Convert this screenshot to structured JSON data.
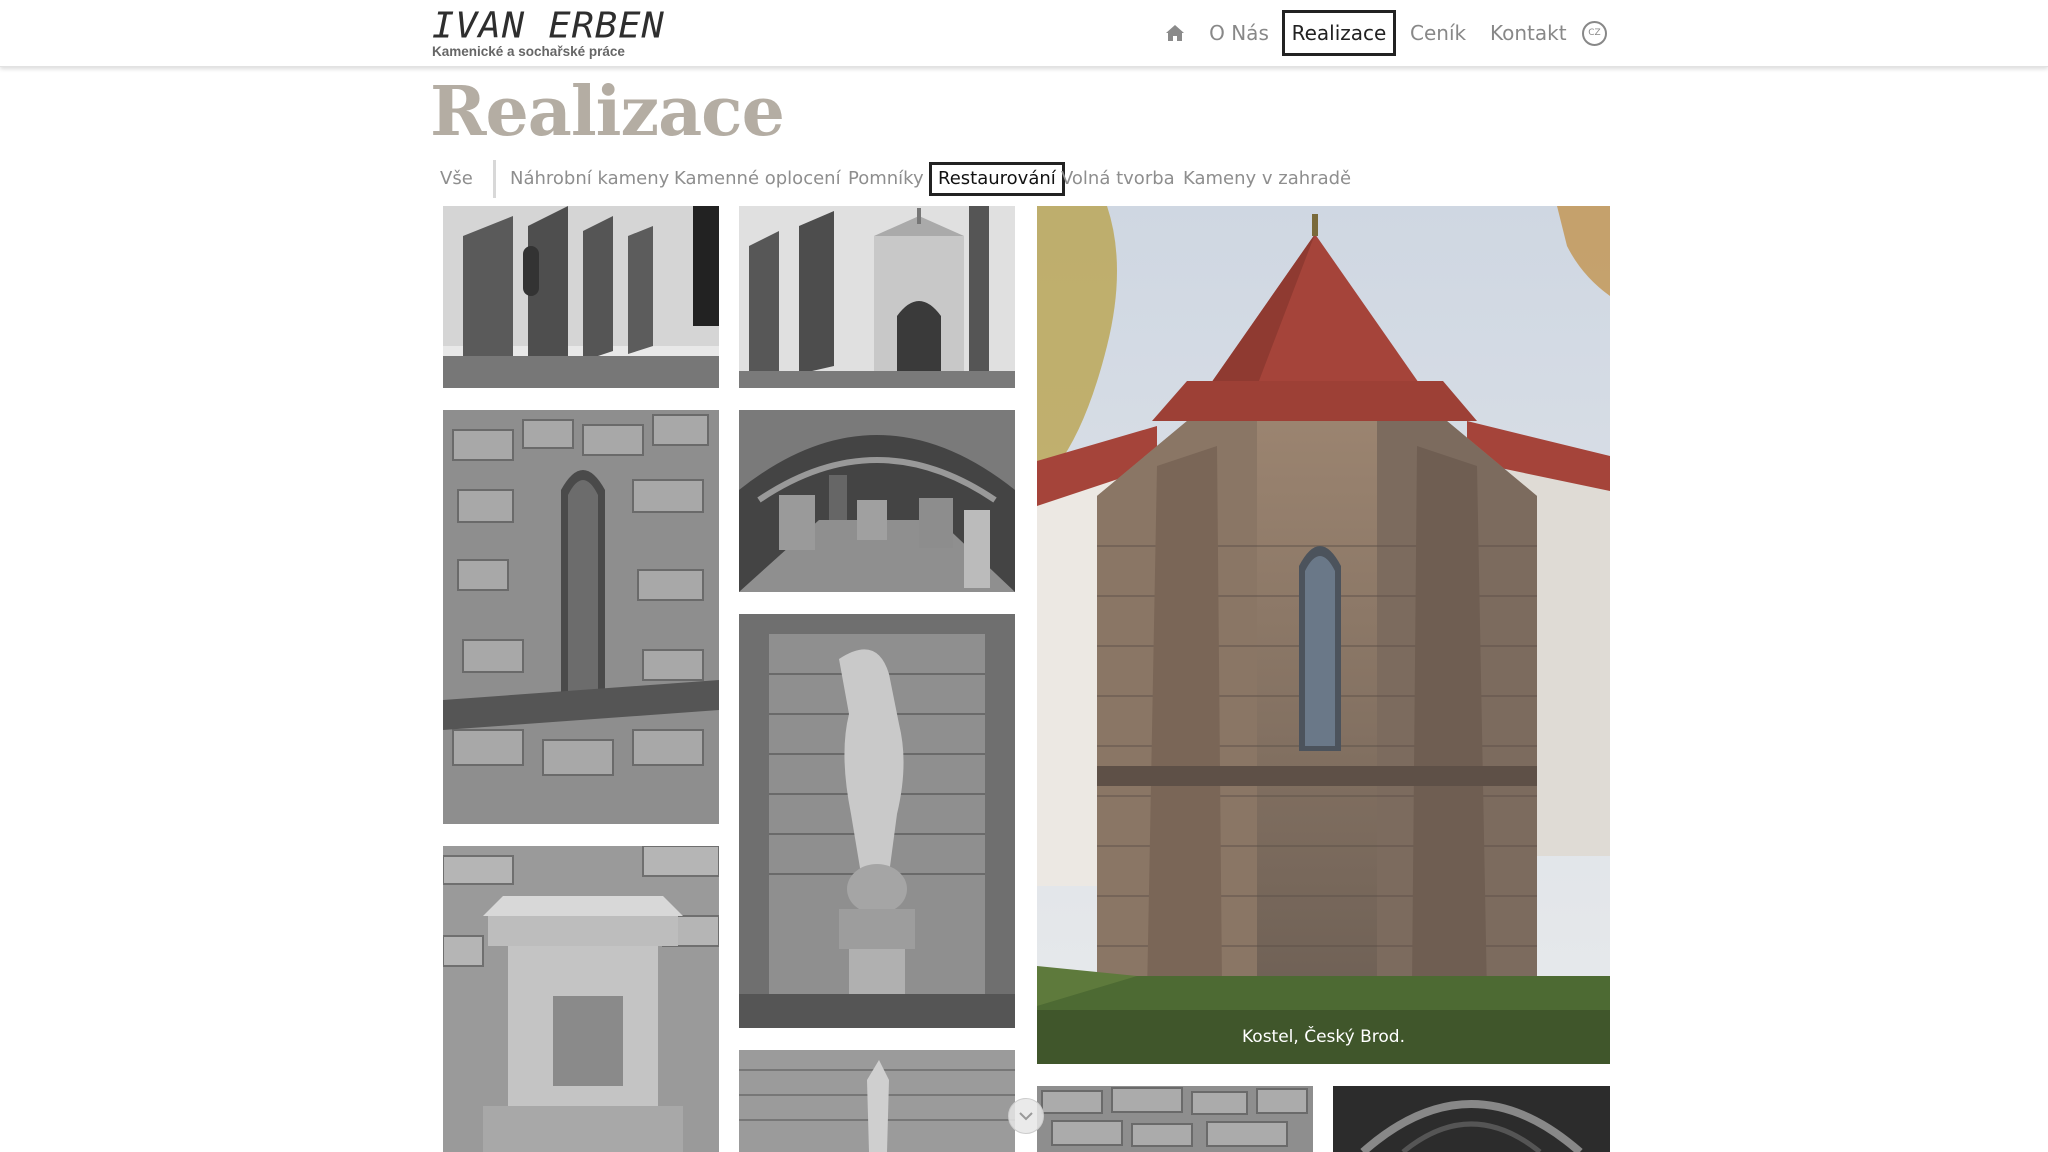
{
  "logo": {
    "title": "IVAN ERBEN",
    "tagline": "Kamenické a sochařské práce"
  },
  "nav": {
    "home_icon": "home-icon",
    "items": [
      {
        "label": "O Nás"
      },
      {
        "label": "Realizace",
        "active": true
      },
      {
        "label": "Ceník"
      },
      {
        "label": "Kontakt"
      }
    ],
    "language": "CZ"
  },
  "page": {
    "title": "Realizace"
  },
  "filters": {
    "all": "Vše",
    "items": [
      {
        "label": "Náhrobní kameny"
      },
      {
        "label": "Kamenné oplocení"
      },
      {
        "label": "Pomníky"
      },
      {
        "label": "Restaurování",
        "active": true
      },
      {
        "label": "Volná tvorba"
      },
      {
        "label": "Kameny v zahradě"
      }
    ]
  },
  "gallery": {
    "featured_caption": "Kostel, Český Brod.",
    "scroll_icon": "chevron-down-icon"
  },
  "colors": {
    "accent_border": "#222222",
    "title_color": "#b4ada3",
    "roof": "#a5443a"
  }
}
